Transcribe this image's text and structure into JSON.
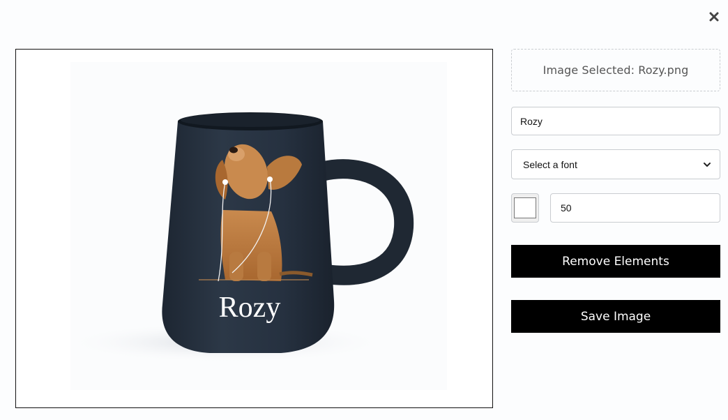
{
  "close": {
    "icon": "close-icon",
    "glyph": "✖"
  },
  "preview": {
    "mug_text": "Rozy",
    "mug_color": "#283341",
    "image_description_icon": "dog-with-headphones-image"
  },
  "controls": {
    "file_status": "Image Selected: Rozy.png",
    "text_value": "Rozy",
    "font_select_value": "Select a font",
    "color_value": "#ffffff",
    "size_value": "50",
    "remove_label": "Remove Elements",
    "save_label": "Save Image"
  }
}
